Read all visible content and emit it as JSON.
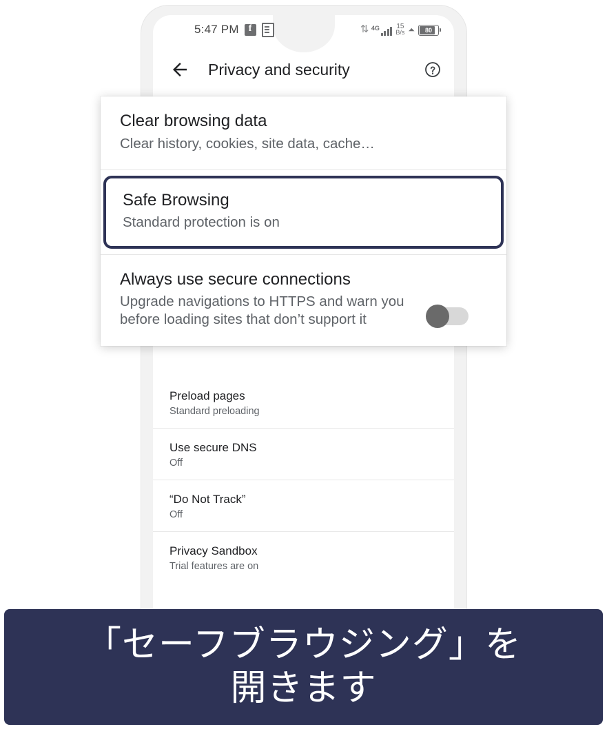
{
  "status_bar": {
    "time": "5:47 PM",
    "icons_left": [
      "facebook-icon",
      "app-notification-icon"
    ],
    "sync_icon": "sync-arrows-icon",
    "network_type": "4G",
    "data_speed_value": "15",
    "data_speed_unit": "B/s",
    "alarm_icon": "alarm-icon",
    "battery_level": "80"
  },
  "header": {
    "back_label": "back-arrow",
    "title": "Privacy and security",
    "help_label": "help-icon"
  },
  "overlay_card": {
    "items": [
      {
        "title": "Clear browsing data",
        "subtitle": "Clear history, cookies, site data, cache…",
        "highlighted": false
      },
      {
        "title": "Safe Browsing",
        "subtitle": "Standard protection is on",
        "highlighted": true
      },
      {
        "title": "Always use secure connections",
        "subtitle": "Upgrade navigations to HTTPS and warn you before loading sites that don’t support it",
        "highlighted": false,
        "toggle": "off"
      }
    ]
  },
  "settings_list": {
    "rows": [
      {
        "title": "Preload pages",
        "subtitle": "Standard preloading"
      },
      {
        "title": "Use secure DNS",
        "subtitle": "Off"
      },
      {
        "title": "“Do Not Track”",
        "subtitle": "Off"
      },
      {
        "title": "Privacy Sandbox",
        "subtitle": "Trial features are on"
      }
    ]
  },
  "caption": {
    "line1": "「セーフブラウジング」を",
    "line2": "開きます"
  },
  "colors": {
    "highlight": "#2e3356",
    "banner_bg": "#2e3356",
    "text_primary": "#202124",
    "text_secondary": "#5f6368"
  }
}
